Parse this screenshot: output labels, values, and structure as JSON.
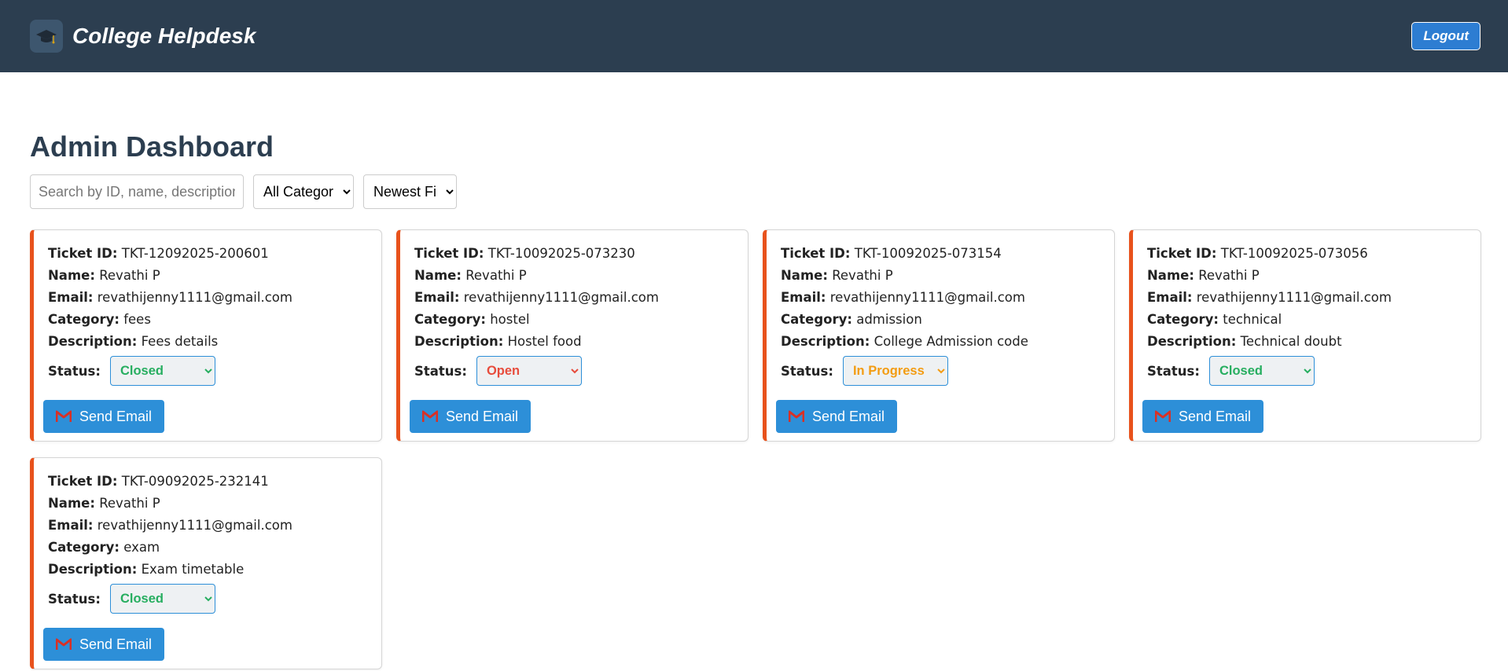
{
  "app": {
    "title": "College Helpdesk",
    "logout_label": "Logout"
  },
  "page": {
    "title": "Admin Dashboard"
  },
  "filters": {
    "search_placeholder": "Search by ID, name, description",
    "category_selected": "All Categories",
    "sort_selected": "Newest First"
  },
  "labels": {
    "ticket_id": "Ticket ID:",
    "name": "Name:",
    "email": "Email:",
    "category": "Category:",
    "description": "Description:",
    "status": "Status:",
    "send_email": "Send Email"
  },
  "tickets": [
    {
      "id": "TKT-12092025-200601",
      "name": "Revathi P",
      "email": "revathijenny1111@gmail.com",
      "category": "fees",
      "description": "Fees details",
      "status": "Closed"
    },
    {
      "id": "TKT-10092025-073230",
      "name": "Revathi P",
      "email": "revathijenny1111@gmail.com",
      "category": "hostel",
      "description": "Hostel food",
      "status": "Open"
    },
    {
      "id": "TKT-10092025-073154",
      "name": "Revathi P",
      "email": "revathijenny1111@gmail.com",
      "category": "admission",
      "description": "College Admission code",
      "status": "In Progress"
    },
    {
      "id": "TKT-10092025-073056",
      "name": "Revathi P",
      "email": "revathijenny1111@gmail.com",
      "category": "technical",
      "description": "Technical doubt",
      "status": "Closed"
    },
    {
      "id": "TKT-09092025-232141",
      "name": "Revathi P",
      "email": "revathijenny1111@gmail.com",
      "category": "exam",
      "description": "Exam timetable",
      "status": "Closed"
    }
  ],
  "colors": {
    "navbar": "#2c3e50",
    "accent": "#2d8fd8",
    "card_border": "#e8521c",
    "status_closed": "#27ae60",
    "status_open": "#e74c3c",
    "status_in_progress": "#f39c12"
  },
  "icons": {
    "logo": "graduation-cap-icon",
    "email": "gmail-icon",
    "dropdown": "chevron-down-icon"
  }
}
